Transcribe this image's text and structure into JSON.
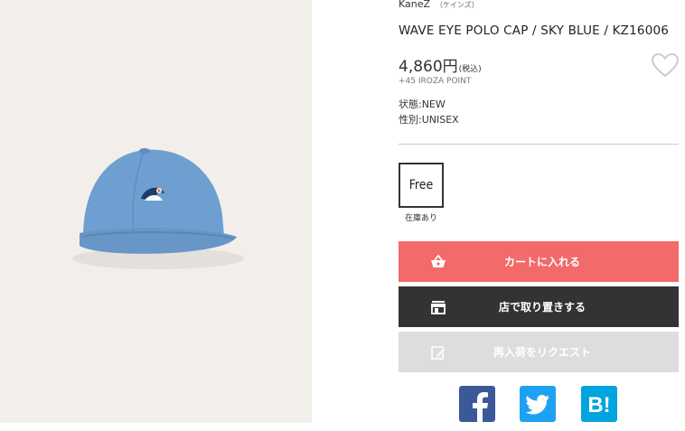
{
  "product": {
    "brand": "KaneZ",
    "brand_kana": "（ケインズ）",
    "title": "WAVE EYE POLO CAP / SKY BLUE / KZ16006",
    "price": "4,860円",
    "tax_label": "(税込)",
    "points": "+45 IROZA POINT",
    "condition": "状態:NEW",
    "gender": "性別:UNISEX"
  },
  "size_option": {
    "label": "Free",
    "stock": "在庫あり"
  },
  "actions": {
    "cart": "カートに入れる",
    "store": "店で取り置きする",
    "request": "再入荷をリクエスト"
  },
  "icons": {
    "cart": "basket-icon",
    "store": "store-icon",
    "request": "edit-icon",
    "favorite": "heart-icon",
    "facebook": "facebook-icon",
    "twitter": "twitter-icon",
    "hatena": "hatena-bookmark-icon"
  },
  "colors": {
    "cart": "#f26a6a",
    "store": "#333333",
    "request": "#dddddd",
    "facebook": "#3b5998",
    "twitter": "#1da1f2",
    "hatena": "#00a4de",
    "cap": "#6f9fd0"
  },
  "hatena_glyph": "B!"
}
